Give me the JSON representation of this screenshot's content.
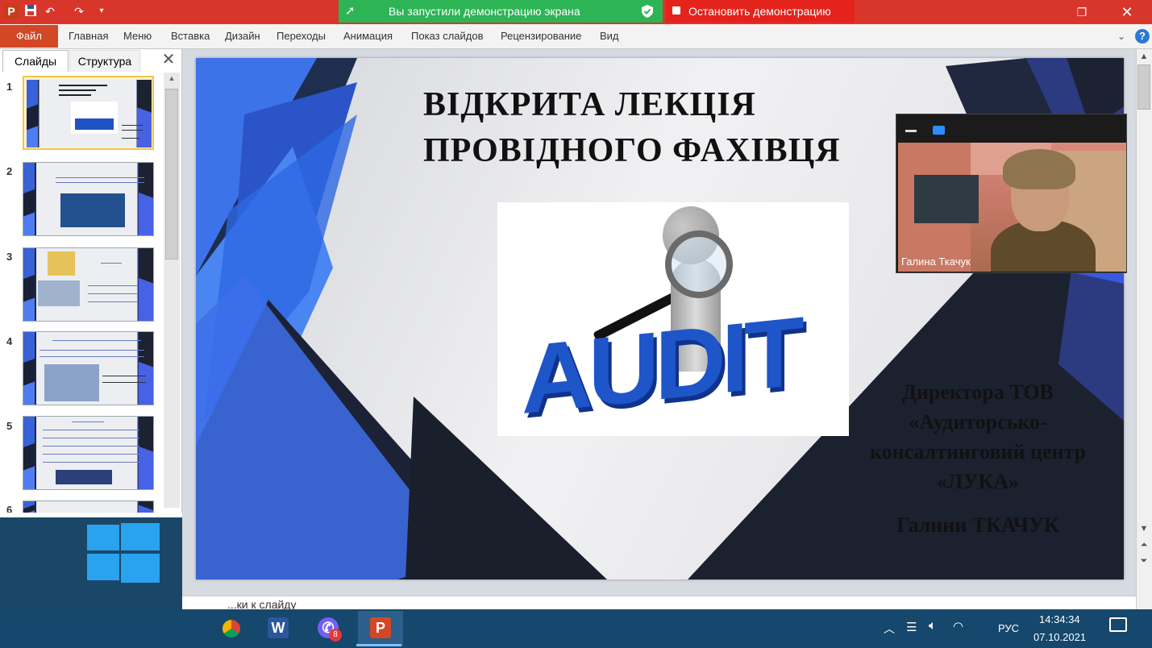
{
  "titlebar": {
    "app_icon_letter": "P",
    "qa_icons": [
      "save-icon",
      "undo-icon",
      "redo-icon",
      "customize-icon"
    ],
    "share_status": "Вы запустили демонстрацию экрана",
    "stop_share": "Остановить демонстрацию",
    "restore_glyph": "❐",
    "close_glyph": "✕"
  },
  "ribbon": {
    "file": "Файл",
    "tabs": [
      "Главная",
      "Меню",
      "Вставка",
      "Дизайн",
      "Переходы",
      "Анимация",
      "Показ слайдов",
      "Рецензирование",
      "Вид"
    ]
  },
  "panel": {
    "tab_slides": "Слайды",
    "tab_outline": "Структура",
    "close_glyph": "✕",
    "numbers": [
      "1",
      "2",
      "3",
      "4",
      "5",
      "6"
    ]
  },
  "slide": {
    "title": "ВІДКРИТА ЛЕКЦІЯ ПРОВІДНОГО ФАХІВЦЯ",
    "audit_word": "AUDIT",
    "subtitle": "Директора ТОВ «Аудиторсько-консалтинговий центр «ЛУКА»",
    "name": "Галини ТКАЧУК"
  },
  "video": {
    "participant_name": "Галина Ткачук"
  },
  "notes": {
    "placeholder_fragment": "...ки к слайду"
  },
  "taskbar": {
    "apps": [
      "chrome-icon",
      "word-icon",
      "viber-icon",
      "powerpoint-icon"
    ],
    "word_letter": "W",
    "powerpoint_letter": "P",
    "viber_badge": "8",
    "language": "РУС",
    "time": "14:34:34",
    "date": "07.10.2021"
  },
  "colors": {
    "title_bar": "#d9362b",
    "share_green": "#2db454",
    "share_red": "#e3231c",
    "file_tab": "#d24726",
    "taskbar": "#16476d",
    "slide_blue": "#2f54d6"
  }
}
